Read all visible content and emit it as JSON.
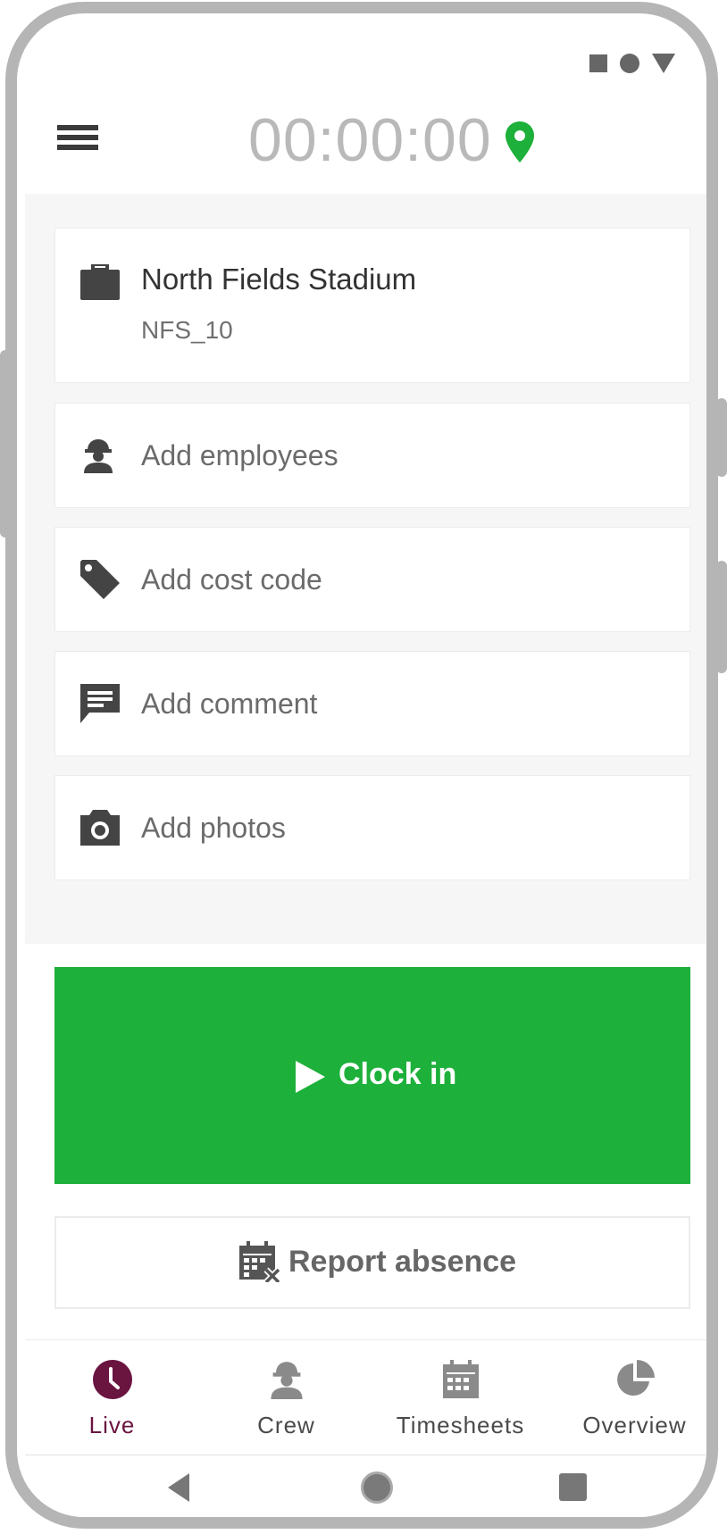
{
  "header": {
    "timer": "00:00:00",
    "menu_icon": "hamburger-menu-icon",
    "location_icon": "location-pin-icon",
    "accent_color": "#1db03a"
  },
  "status_bar": {
    "icons": [
      "square-icon",
      "circle-icon",
      "triangle-icon"
    ]
  },
  "job": {
    "icon": "briefcase-icon",
    "name": "North Fields Stadium",
    "code": "NFS_10"
  },
  "actions": [
    {
      "icon": "worker-icon",
      "label": "Add employees"
    },
    {
      "icon": "tag-icon",
      "label": "Add cost code"
    },
    {
      "icon": "comment-icon",
      "label": "Add comment"
    },
    {
      "icon": "camera-icon",
      "label": "Add photos"
    }
  ],
  "clock_in": {
    "label": "Clock in",
    "icon": "play-icon",
    "color": "#1db03a"
  },
  "report_absence": {
    "label": "Report absence",
    "icon": "calendar-x-icon"
  },
  "bottom_nav": [
    {
      "label": "Live",
      "icon": "clock-icon",
      "active": true,
      "color": "#6a1440"
    },
    {
      "label": "Crew",
      "icon": "worker-icon",
      "active": false
    },
    {
      "label": "Timesheets",
      "icon": "calendar-icon",
      "active": false
    },
    {
      "label": "Overview",
      "icon": "pie-chart-icon",
      "active": false
    }
  ],
  "system_nav": {
    "icons": [
      "back-icon",
      "home-icon",
      "recents-icon"
    ]
  }
}
